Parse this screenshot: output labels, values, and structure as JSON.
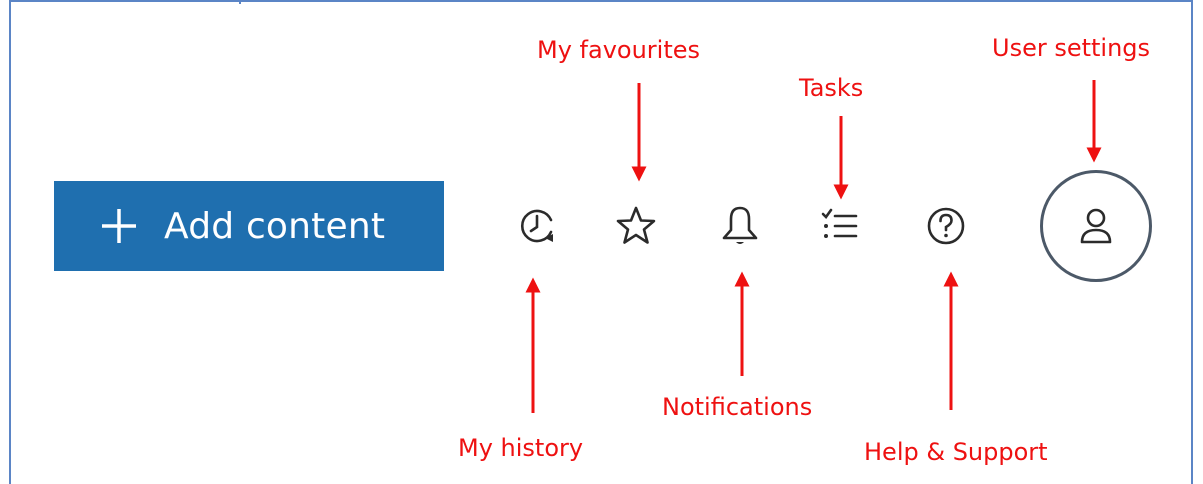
{
  "toolbar": {
    "add_content_label": "Add content"
  },
  "icons": {
    "history": "clock-history-icon",
    "favourites": "star-icon",
    "notifications": "bell-icon",
    "tasks": "checklist-icon",
    "help": "question-icon",
    "user": "user-icon"
  },
  "annotations": {
    "my_favourites": "My favourites",
    "tasks": "Tasks",
    "user_settings": "User settings",
    "my_history": "My history",
    "notifications": "Notifications",
    "help_support": "Help & Support"
  },
  "colors": {
    "accent": "#1f6faf",
    "annotation": "#ee1111",
    "icon": "#2b2b2b",
    "frame": "#5b85c6"
  }
}
